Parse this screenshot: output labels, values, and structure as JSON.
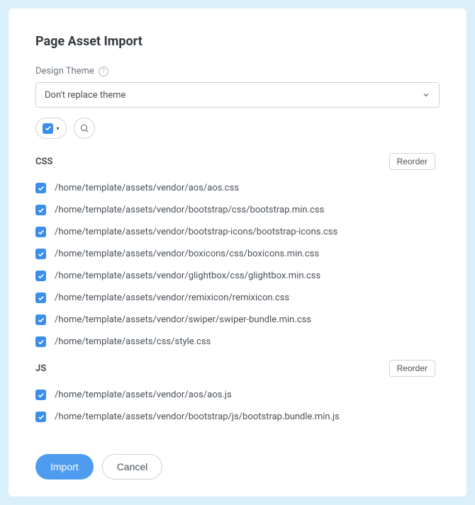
{
  "title": "Page Asset Import",
  "theme": {
    "label": "Design Theme",
    "selected": "Don't replace theme"
  },
  "groups": [
    {
      "key": "css",
      "label": "CSS",
      "reorder_label": "Reorder",
      "items": [
        "/home/template/assets/vendor/aos/aos.css",
        "/home/template/assets/vendor/bootstrap/css/bootstrap.min.css",
        "/home/template/assets/vendor/bootstrap-icons/bootstrap-icons.css",
        "/home/template/assets/vendor/boxicons/css/boxicons.min.css",
        "/home/template/assets/vendor/glightbox/css/glightbox.min.css",
        "/home/template/assets/vendor/remixicon/remixicon.css",
        "/home/template/assets/vendor/swiper/swiper-bundle.min.css",
        "/home/template/assets/css/style.css"
      ]
    },
    {
      "key": "js",
      "label": "JS",
      "reorder_label": "Reorder",
      "items": [
        "/home/template/assets/vendor/aos/aos.js",
        "/home/template/assets/vendor/bootstrap/js/bootstrap.bundle.min.js"
      ]
    }
  ],
  "footer": {
    "import_label": "Import",
    "cancel_label": "Cancel"
  }
}
